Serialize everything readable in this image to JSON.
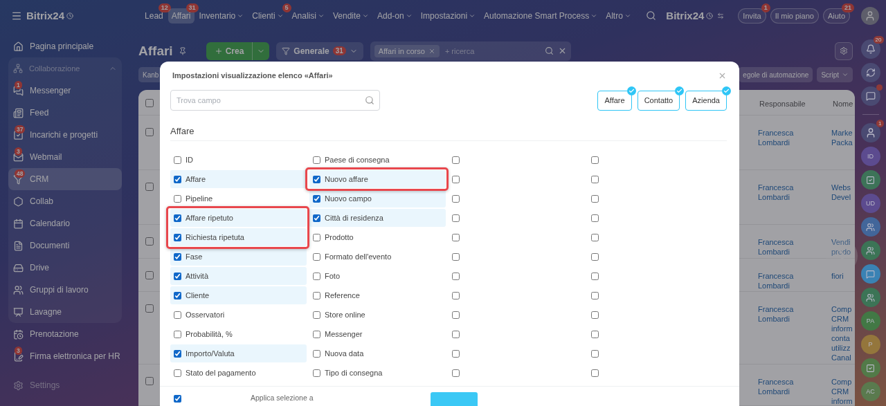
{
  "top_bar": {
    "logo": "Bitrix24",
    "nav": [
      {
        "label": "Lead",
        "badge": "12",
        "has_menu": false,
        "selected": false
      },
      {
        "label": "Affari",
        "badge": "31",
        "has_menu": false,
        "selected": true
      },
      {
        "label": "Inventario",
        "has_menu": true,
        "selected": false
      },
      {
        "label": "Clienti",
        "badge": "5",
        "has_menu": true,
        "selected": false
      },
      {
        "label": "Analisi",
        "has_menu": true,
        "selected": false
      },
      {
        "label": "Vendite",
        "has_menu": true,
        "selected": false
      },
      {
        "label": "Add-on",
        "has_menu": true,
        "selected": false
      },
      {
        "label": "Impostazioni",
        "has_menu": true,
        "selected": false
      },
      {
        "label": "Automazione Smart Process",
        "has_menu": true,
        "selected": false
      },
      {
        "label": "Altro",
        "has_menu": true,
        "selected": false
      }
    ],
    "brand": "Bitrix24",
    "buttons": [
      {
        "label": "Invita",
        "badge": "1"
      },
      {
        "label": "Il mio piano"
      },
      {
        "label": "Aiuto",
        "badge": "21"
      }
    ]
  },
  "sidebar": {
    "items": [
      {
        "kind": "item",
        "label": "Pagina principale",
        "selected": false
      },
      {
        "kind": "group",
        "label": "Collaborazione",
        "expanded": true,
        "children": [
          {
            "label": "Messenger",
            "badge": "1",
            "selected": false
          },
          {
            "label": "Feed",
            "selected": false
          },
          {
            "label": "Incarichi e progetti",
            "badge": "37",
            "selected": false
          },
          {
            "label": "Webmail",
            "badge": "3",
            "selected": false
          },
          {
            "label": "CRM",
            "badge": "48",
            "selected": true
          },
          {
            "label": "Collab",
            "selected": false
          },
          {
            "label": "Calendario",
            "selected": false
          },
          {
            "label": "Documenti",
            "selected": false
          },
          {
            "label": "Drive",
            "selected": false
          },
          {
            "label": "Gruppi di lavoro",
            "selected": false
          },
          {
            "label": "Lavagne",
            "selected": false
          }
        ]
      },
      {
        "kind": "item",
        "label": "Prenotazione",
        "selected": false
      },
      {
        "kind": "item",
        "label": "Firma elettronica per HR",
        "badge": "3",
        "selected": false
      },
      {
        "kind": "item",
        "label": "Settings",
        "selected": false
      }
    ]
  },
  "header": {
    "title": "Affari",
    "create": "Crea",
    "preset": {
      "label": "Generale",
      "badge": "31"
    },
    "filter_tag": "Affari in corso",
    "search_placeholder": "+ ricerca"
  },
  "toolbar": {
    "left": "Kanb",
    "right": [
      {
        "label": "egole di automazione",
        "has_menu": false
      },
      {
        "label": "Script",
        "has_menu": true
      }
    ]
  },
  "table": {
    "columns": [
      "Responsabile",
      "Nome"
    ],
    "select_all_checked": false,
    "rows": [
      {
        "checked": false,
        "responsible": "Francesca Lombardi",
        "name": [
          "Marke",
          "Packa"
        ]
      },
      {
        "checked": false,
        "responsible": "Francesca Lombardi",
        "name": [
          "Webs",
          "Devel"
        ]
      },
      {
        "checked": false,
        "responsible": "Francesca Lombardi",
        "name": [
          "Vendi",
          "prodo"
        ]
      },
      {
        "checked": false,
        "responsible": "Francesca Lombardi",
        "name": [
          "fiori"
        ]
      },
      {
        "checked": false,
        "responsible": "Francesca Lombardi",
        "name": [
          "Comp",
          "CRM",
          "inform",
          "conta",
          "utilizz",
          "Canal"
        ]
      },
      {
        "checked": false,
        "responsible": "Francesca Lombardi",
        "name": [
          "Comp",
          "CRM",
          "inform"
        ]
      }
    ]
  },
  "right_rail": [
    {
      "kind": "bell",
      "badge": "20"
    },
    {
      "kind": "spiral"
    },
    {
      "kind": "chat",
      "alert": true
    },
    {
      "kind": "avatar",
      "badge": "1"
    },
    {
      "kind": "initials",
      "text": "ID",
      "color": "#5c4b8f"
    },
    {
      "kind": "task",
      "color": "#3d7358"
    },
    {
      "kind": "initials",
      "text": "UD",
      "color": "#5c4b8f"
    },
    {
      "kind": "group",
      "color": "#42669a"
    },
    {
      "kind": "group",
      "color": "#3c7456"
    },
    {
      "kind": "message",
      "color": "#3a82b4"
    },
    {
      "kind": "group",
      "color": "#3c7456"
    },
    {
      "kind": "initials",
      "text": "PA",
      "color": "#427845"
    },
    {
      "kind": "initials",
      "text": "P",
      "color": "#94763c"
    },
    {
      "kind": "task",
      "color": "#527a48"
    },
    {
      "kind": "initials",
      "text": "AC",
      "color": "#5a7a4e"
    }
  ],
  "modal": {
    "title": "Impostazioni visualizzazione elenco «Affari»",
    "search_placeholder": "Trova campo",
    "entities": [
      {
        "label": "Affare",
        "selected": true
      },
      {
        "label": "Contatto",
        "selected": true
      },
      {
        "label": "Azienda",
        "selected": true
      }
    ],
    "section": "Affare",
    "rows": [
      [
        {
          "label": "ID",
          "checked": false,
          "outlined": false
        },
        {
          "label": "Paese di consegna",
          "checked": false,
          "outlined": false
        },
        {
          "checked": false,
          "outlined": false
        },
        {
          "checked": false,
          "outlined": false
        }
      ],
      [
        {
          "label": "Affare",
          "checked": true,
          "outlined": false
        },
        {
          "label": "Nuovo affare",
          "checked": true,
          "outlined": true
        },
        {
          "checked": false,
          "outlined": false
        },
        {
          "checked": false,
          "outlined": false
        }
      ],
      [
        {
          "label": "Pipeline",
          "checked": false,
          "outlined": false
        },
        {
          "label": "Nuovo campo",
          "checked": true,
          "outlined": false
        },
        {
          "checked": false,
          "outlined": false
        },
        {
          "checked": false,
          "outlined": false
        }
      ],
      [
        {
          "label": "Affare ripetuto",
          "checked": true,
          "outlined": true
        },
        {
          "label": "Città di residenza",
          "checked": true,
          "outlined": false
        },
        {
          "checked": false,
          "outlined": false
        },
        {
          "checked": false,
          "outlined": false
        }
      ],
      [
        {
          "label": "Richiesta ripetuta",
          "checked": true,
          "outlined": true
        },
        {
          "label": "Prodotto",
          "checked": false,
          "outlined": false
        },
        {
          "checked": false,
          "outlined": false
        },
        {
          "checked": false,
          "outlined": false
        }
      ],
      [
        {
          "label": "Fase",
          "checked": true,
          "outlined": false
        },
        {
          "label": "Formato dell'evento",
          "checked": false,
          "outlined": false
        },
        {
          "checked": false,
          "outlined": false
        },
        {
          "checked": false,
          "outlined": false
        }
      ],
      [
        {
          "label": "Attività",
          "checked": true,
          "outlined": false
        },
        {
          "label": "Foto",
          "checked": false,
          "outlined": false
        },
        {
          "checked": false,
          "outlined": false
        },
        {
          "checked": false,
          "outlined": false
        }
      ],
      [
        {
          "label": "Cliente",
          "checked": true,
          "outlined": false
        },
        {
          "label": "Reference",
          "checked": false,
          "outlined": false
        },
        {
          "checked": false,
          "outlined": false
        },
        {
          "checked": false,
          "outlined": false
        }
      ],
      [
        {
          "label": "Osservatori",
          "checked": false,
          "outlined": false
        },
        {
          "label": "Store online",
          "checked": false,
          "outlined": false
        },
        {
          "checked": false,
          "outlined": false
        },
        {
          "checked": false,
          "outlined": false
        }
      ],
      [
        {
          "label": "Probabilità, %",
          "checked": false,
          "outlined": false
        },
        {
          "label": "Messenger",
          "checked": false,
          "outlined": false
        },
        {
          "checked": false,
          "outlined": false
        },
        {
          "checked": false,
          "outlined": false
        }
      ],
      [
        {
          "label": "Importo/Valuta",
          "checked": true,
          "outlined": false
        },
        {
          "label": "Nuova data",
          "checked": false,
          "outlined": false
        },
        {
          "checked": false,
          "outlined": false
        },
        {
          "checked": false,
          "outlined": false
        }
      ],
      [
        {
          "label": "Stato del pagamento",
          "checked": false,
          "outlined": false
        },
        {
          "label": "Tipo di consegna",
          "checked": false,
          "outlined": false
        },
        {
          "checked": false,
          "outlined": false
        },
        {
          "checked": false,
          "outlined": false
        }
      ]
    ],
    "footer": {
      "option_checked": true,
      "apply_label": "Applica selezione a"
    }
  }
}
